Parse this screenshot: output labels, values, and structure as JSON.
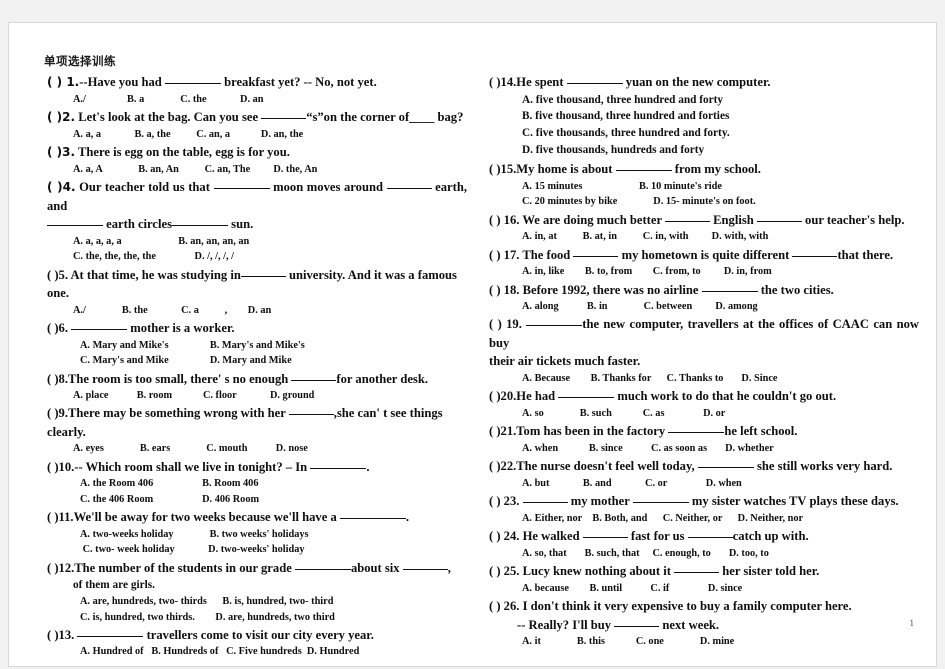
{
  "document": {
    "title": "单项选择训练",
    "page_number": "1"
  },
  "left_column": [
    {
      "id": "q1",
      "marker": "(  ) 1.",
      "stem_before": "--Have you had ",
      "stem_after": " breakfast yet?        -- No, not yet.",
      "options": "A./                B. a              C. the             D. an"
    },
    {
      "id": "q2",
      "marker": "(  )2.",
      "stem_before": "Let's look at the bag. Can you see ",
      "stem_after": "“s”on the corner of____ bag?",
      "options": "A. a, a             B. a, the          C. an, a            D. an, the"
    },
    {
      "id": "q3",
      "marker": "(  )3.",
      "stem_before": "There is         egg on the table,         egg is for you.",
      "stem_after": "",
      "options": "A. a, A              B. an, An          C. an, The         D. the, An"
    },
    {
      "id": "q4",
      "marker": "(  )4.",
      "stem_before": "Our teacher told us that ",
      "stem_after": " moon moves around ",
      "stem_tail": " earth, and",
      "cont_before": "",
      "cont_mid": " earth circles",
      "cont_after": " sun.",
      "options_a": "A. a, a, a, a                      B. an, an, an, an",
      "options_b": "C. the, the, the, the               D. /, /, /, /"
    },
    {
      "id": "q5",
      "marker": "(  )5.",
      "stem_before": "At that time, he was studying in",
      "stem_after": " university. And it was a famous one.",
      "options": "A./              B. the             C. a          ,        D. an"
    },
    {
      "id": "q6",
      "marker": "(  )6.",
      "stem_before": "",
      "stem_after": " mother is a worker.",
      "options_a": "A. Mary and Mike's                B. Mary's and Mike's",
      "options_b": "C. Mary's and Mike                D. Mary and Mike"
    },
    {
      "id": "q8",
      "marker": "(  )8.",
      "stem_before": "The room is too small, there' s no enough ",
      "stem_after": "for another desk.",
      "options": "A. place           B. room            C. floor             D. ground"
    },
    {
      "id": "q9",
      "marker": "(  )9.",
      "stem_before": "There may be something wrong with her ",
      "stem_after": ",she can' t see things clearly.",
      "options": "A. eyes              B. ears              C. mouth           D. nose"
    },
    {
      "id": "q10",
      "marker": "(  )10.",
      "stem_before": "-- Which room shall we live in tonight? – In ",
      "stem_after": ".",
      "options_a": "A. the Room 406                   B. Room 406",
      "options_b": "C. the 406 Room                   D. 406 Room"
    },
    {
      "id": "q11",
      "marker": "(  )11.",
      "stem_before": "We'll be away for two weeks because we'll have a ",
      "stem_after": ".",
      "options_a": "A. two-weeks holiday              B. two weeks' holidays",
      "options_b": " C. two- week holiday             D. two-weeks' holiday"
    },
    {
      "id": "q12",
      "marker": "(  )12.",
      "stem_before": "The number of the students in our grade ",
      "stem_after": "about six ",
      "stem_tail": ",",
      "cont": "of them are girls.",
      "options_a": "A. are, hundreds, two- thirds      B. is, hundred, two- third",
      "options_b": "C. is, hundred, two thirds.        D. are, hundreds, two third"
    },
    {
      "id": "q13",
      "marker": "(  )13.",
      "stem_before": "",
      "stem_after": " travellers come to visit our city every year.",
      "options": "A. Hundred of   B. Hundreds of   C. Five hundreds  D. Hundred"
    }
  ],
  "right_column": [
    {
      "id": "q14",
      "marker": "(  )14.",
      "stem_before": "He spent ",
      "stem_after": " yuan on the new computer.",
      "option_lines": [
        "A. five thousand, three hundred and forty",
        "B. five thousand, three hundred and forties",
        "C. five thousands, three hundred and forty.",
        "D. five thousands, hundreds and forty"
      ]
    },
    {
      "id": "q15",
      "marker": "(  )15.",
      "stem_before": "My home is about ",
      "stem_after": " from my school.",
      "options_a": "A. 15 minutes                      B. 10 minute's ride",
      "options_b": "C. 20 minutes by bike              D. 15- minute's on foot."
    },
    {
      "id": "q16",
      "marker": "(  ) 16.",
      "stem_before": "We are doing much better ",
      "stem_after": " English ",
      "stem_tail": " our teacher's help.",
      "options": "A. in, at          B. at, in          C. in, with         D. with, with"
    },
    {
      "id": "q17",
      "marker": "(  ) 17.",
      "stem_before": "The food ",
      "stem_after": " my hometown is quite different ",
      "stem_tail": "that there.",
      "options": "A. in, like        B. to, from        C. from, to         D. in, from"
    },
    {
      "id": "q18",
      "marker": "(  ) 18.",
      "stem_before": "Before 1992, there was no airline ",
      "stem_after": " the two cities.",
      "options": "A. along           B. in              C. between         D. among"
    },
    {
      "id": "q19",
      "marker": "(  ) 19.",
      "stem_before": "",
      "stem_after": "the new computer, travellers at the offices of CAAC can now buy",
      "cont": "their air tickets much faster.",
      "options": "A. Because        B. Thanks for      C. Thanks to       D. Since"
    },
    {
      "id": "q20",
      "marker": "(  )20.",
      "stem_before": "He had ",
      "stem_after": " much work to do that he couldn't go out.",
      "options": "A. so              B. such            C. as               D. or"
    },
    {
      "id": "q21",
      "marker": "(  )21.",
      "stem_before": "Tom has been in the factory ",
      "stem_after": "he left school.",
      "options": "A. when            B. since           C. as soon as       D. whether"
    },
    {
      "id": "q22",
      "marker": "(  )22.",
      "stem_before": "The nurse doesn't feel well today, ",
      "stem_after": " she still works very hard.",
      "options": "A. but             B. and             C. or               D. when"
    },
    {
      "id": "q23",
      "marker": "(  ) 23.",
      "stem_before": "",
      "stem_after": " my mother ",
      "stem_tail": " my sister watches TV plays these days.",
      "options": "A. Either, nor    B. Both, and      C. Neither, or      D. Neither, nor"
    },
    {
      "id": "q24",
      "marker": "(  ) 24.",
      "stem_before": "He walked ",
      "stem_after": " fast for us ",
      "stem_tail": "catch up with.",
      "options": "A. so, that       B. such, that     C. enough, to       D. too, to"
    },
    {
      "id": "q25",
      "marker": "(  ) 25.",
      "stem_before": "Lucy knew nothing about it ",
      "stem_after": " her sister told her.",
      "options": "A. because        B. until           C. if               D. since"
    },
    {
      "id": "q26",
      "marker": "(  ) 26.",
      "stem_before": "I don't think it very expensive to buy a family computer here.",
      "stem_after": "",
      "cont_before": "-- Really? I'll buy ",
      "cont_after": " next week.",
      "options": "A. it              B. this            C. one              D. mine"
    }
  ]
}
